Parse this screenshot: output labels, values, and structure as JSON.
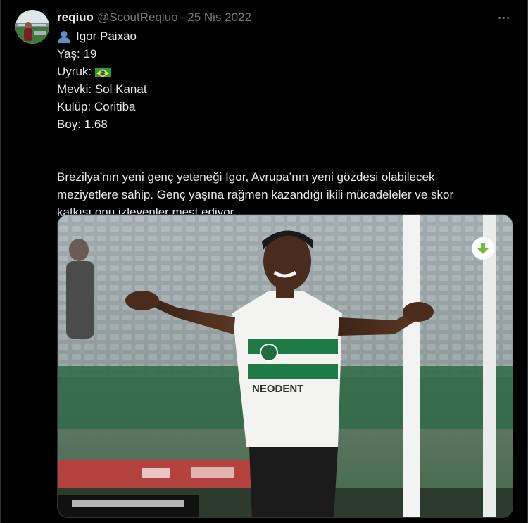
{
  "tweet": {
    "display_name": "reqiuo",
    "handle": "@ScoutReqiuo",
    "separator": "·",
    "date": "25 Nis 2022",
    "lines": {
      "name": "Igor Paixao",
      "age": "Yaş: 19",
      "nationality": "Uyruk:",
      "position": "Mevki: Sol Kanat",
      "club": "Kulüp: Coritiba",
      "height": "Boy: 1.68"
    },
    "paragraph": [
      "Brezilya’nın yeni genç yeteneği Igor, Avrupa’nın yeni gözdesi olabilecek",
      "meziyetlere sahip. Genç yaşına rağmen kazandığı ikili mücadeleler ve skor",
      "katkısı onu izleyenler mest ediyor."
    ],
    "icons": {
      "person_emoji": "bust-in-silhouette-icon",
      "nationality_flag": "brazil-flag-icon",
      "more": "more-options-icon",
      "download": "download-arrow-icon"
    },
    "jersey_sponsor": "NEODENT",
    "colors": {
      "background": "#000000",
      "text": "#e7e9ea",
      "secondary_text": "#71767b",
      "download_arrow": "#6bbf3a",
      "jersey_green": "#1f7a45"
    }
  }
}
